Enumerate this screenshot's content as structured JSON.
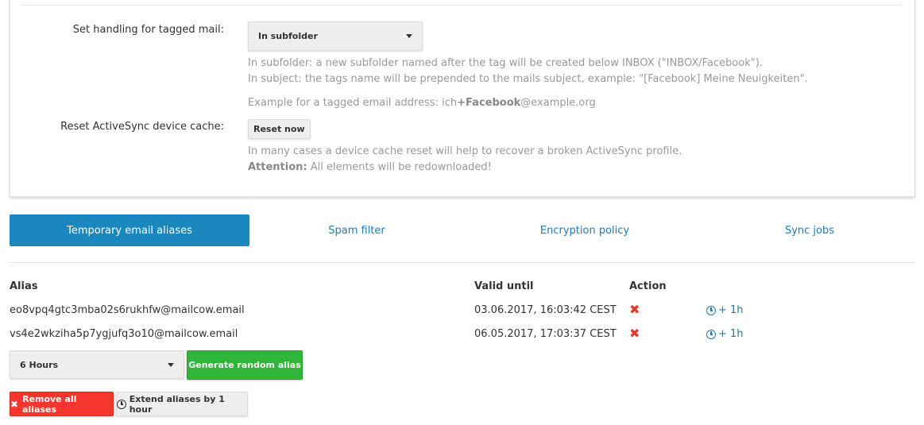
{
  "settings": {
    "tagged_mail_label": "Set handling for tagged mail:",
    "tagged_mail_value": "In subfolder",
    "help_line1": "In subfolder: a new subfolder named after the tag will be created below INBOX (\"INBOX/Facebook\").",
    "help_line2": "In subject: the tags name will be prepended to the mails subject, example: \"[Facebook] Meine Neuigkeiten\".",
    "example_prefix": "Example for a tagged email address: ich",
    "example_tag": "+Facebook",
    "example_suffix": "@example.org",
    "reset_label": "Reset ActiveSync device cache:",
    "reset_button": "Reset now",
    "reset_help": "In many cases a device cache reset will help to recover a broken ActiveSync profile.",
    "attention_label": "Attention:",
    "attention_text": " All elements will be redownloaded!"
  },
  "tabs": [
    {
      "label": "Temporary email aliases",
      "active": true
    },
    {
      "label": "Spam filter",
      "active": false
    },
    {
      "label": "Encryption policy",
      "active": false
    },
    {
      "label": "Sync jobs",
      "active": false
    }
  ],
  "table": {
    "headers": [
      "Alias",
      "Valid until",
      "Action"
    ],
    "rows": [
      {
        "alias": "eo8vpq4gtc3mba02s6rukhfw@mailcow.email",
        "valid_until": "03.06.2017, 16:03:42 CEST",
        "extend": "+ 1h"
      },
      {
        "alias": "vs4e2wkziha5p7ygjufq3o10@mailcow.email",
        "valid_until": "06.05.2017, 17:03:37 CEST",
        "extend": "+ 1h"
      }
    ]
  },
  "controls": {
    "duration_value": "6 Hours",
    "generate_button": "Generate random alias",
    "remove_all_button": "Remove all aliases",
    "extend_all_button": "Extend aliases by 1 hour"
  },
  "colors": {
    "primary": "#1b87bf",
    "success": "#2fb537",
    "danger": "#f4362f",
    "link": "#1e7ab8"
  }
}
